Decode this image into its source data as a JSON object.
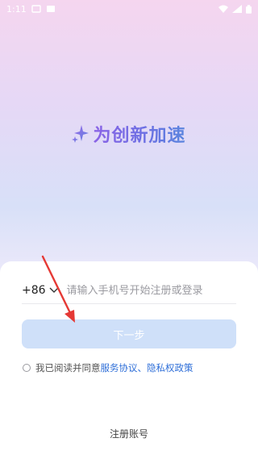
{
  "status_bar": {
    "time": "1:11",
    "icons": [
      "notification-icon",
      "gallery-icon",
      "wifi-icon",
      "signal-icon",
      "battery-icon"
    ]
  },
  "slogan": {
    "text": "为创新加速",
    "icon": "sparkle-icon"
  },
  "login": {
    "country_code": "+86",
    "phone_placeholder": "请输入手机号开始注册或登录",
    "next_button": "下一步",
    "agree_prefix": "我已阅读并同意",
    "service_link": "服务协议",
    "separator": "、",
    "privacy_link": "隐私权政策",
    "register": "注册账号"
  },
  "colors": {
    "accent": "#2f6fd8",
    "button_bg": "#cfe0f9",
    "annotation_arrow": "#e53935"
  }
}
